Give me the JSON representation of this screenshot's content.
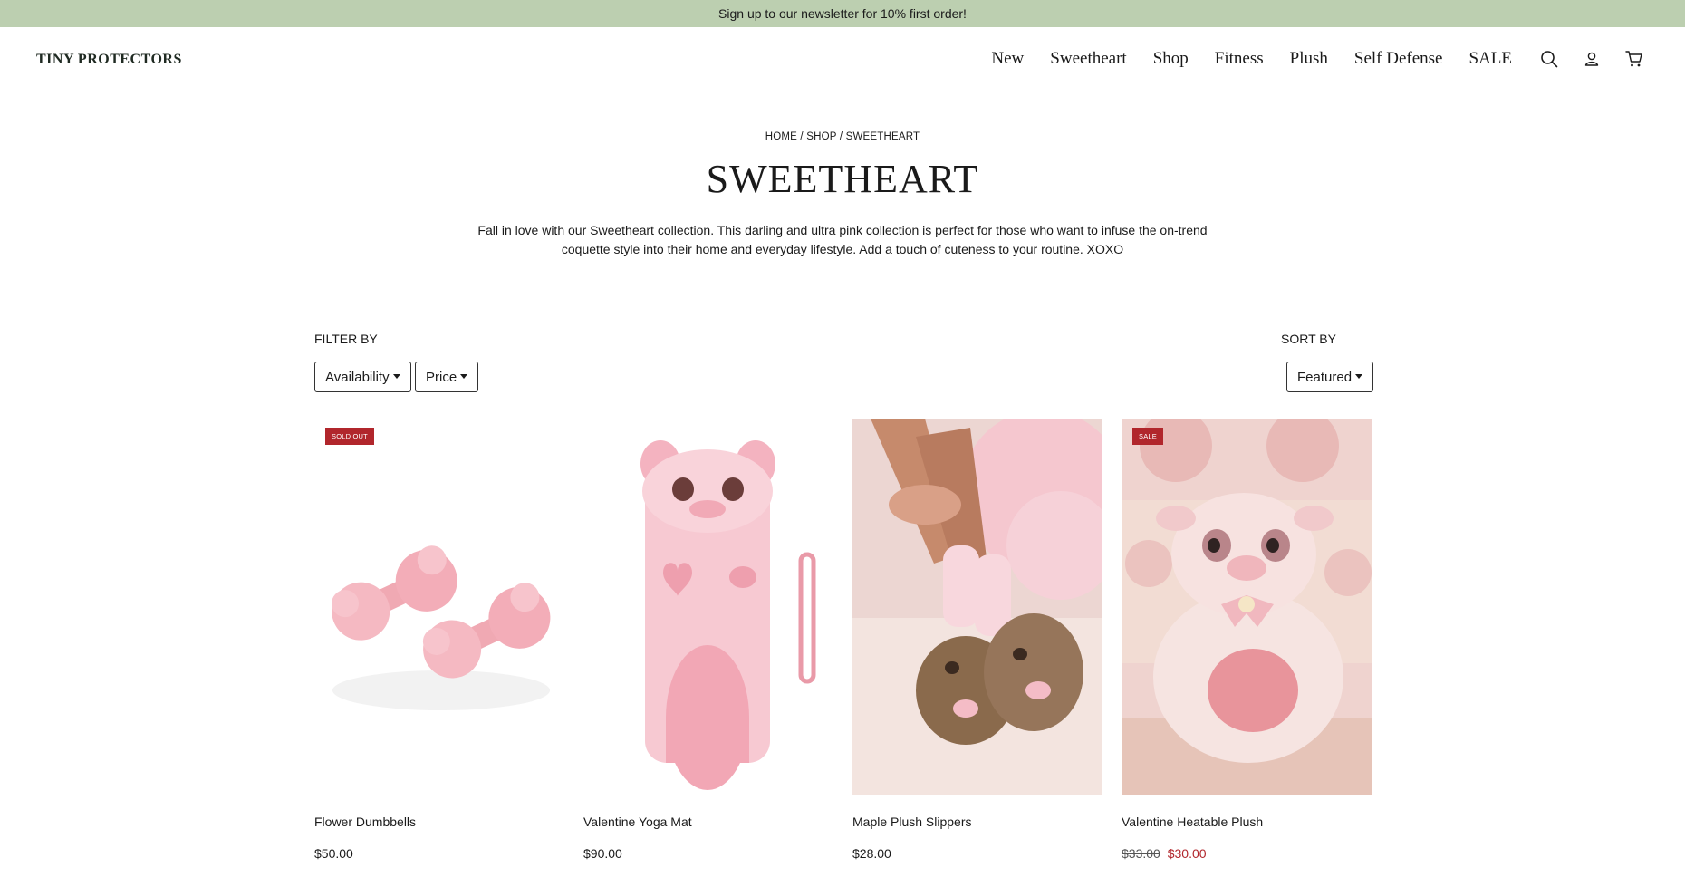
{
  "announcement": "Sign up to our newsletter for 10% first order!",
  "logo": {
    "text": "TINY PROTECTORS"
  },
  "nav": {
    "items": [
      "New",
      "Sweetheart",
      "Shop",
      "Fitness",
      "Plush",
      "Self Defense",
      "SALE"
    ],
    "icons": [
      "search-icon",
      "account-icon",
      "cart-icon"
    ]
  },
  "breadcrumb": {
    "home": "HOME",
    "shop": "SHOP",
    "current": "SWEETHEART",
    "sep": "/"
  },
  "page": {
    "title": "SWEETHEART",
    "description": "Fall in love with our Sweetheart collection. This darling and ultra pink collection is perfect for those who want to infuse the on-trend coquette style into their home and everyday lifestyle. Add a touch of cuteness to your routine. XOXO"
  },
  "filters": {
    "label": "FILTER BY",
    "availability": "Availability",
    "price": "Price"
  },
  "sort": {
    "label": "SORT BY",
    "selected": "Featured"
  },
  "products": [
    {
      "name": "Flower Dumbbells",
      "price": "$50.00",
      "badge": "SOLD OUT"
    },
    {
      "name": "Valentine Yoga Mat",
      "price": "$90.00"
    },
    {
      "name": "Maple Plush Slippers",
      "price": "$28.00"
    },
    {
      "name": "Valentine Heatable Plush",
      "price_old": "$33.00",
      "price_new": "$30.00",
      "badge": "SALE"
    }
  ],
  "colors": {
    "announcement_bg": "#bccfb0",
    "badge": "#b1262c",
    "sale_price": "#b1262c",
    "product_pink": "#f4b8c1"
  }
}
